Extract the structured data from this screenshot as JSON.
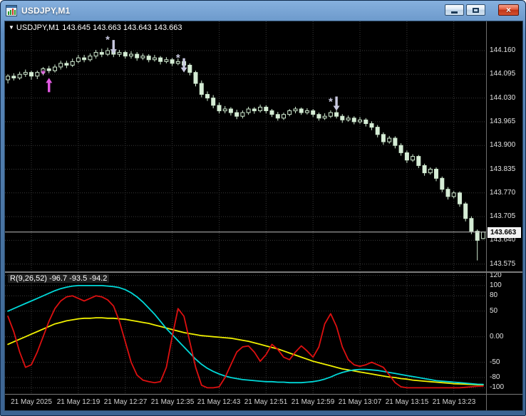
{
  "window": {
    "title": "USDJPY,M1",
    "close_glyph": "×"
  },
  "chart": {
    "symbol_header": {
      "dropdown_glyph": "▼",
      "symbol": "USDJPY,M1",
      "ohlc_values": "143.645 143.663 143.643 143.663"
    },
    "indicator_header": "R(9,26,52) -96.7 -93.5 -94.2",
    "price_axis": {
      "labels": [
        "144.160",
        "144.095",
        "144.030",
        "143.965",
        "143.900",
        "143.835",
        "143.770",
        "143.705",
        "143.640",
        "143.575"
      ],
      "current_price": "143.663"
    },
    "indicator_axis": {
      "labels": [
        "120",
        "100",
        "80",
        "50",
        "0.00",
        "-50",
        "-80",
        "-100"
      ]
    },
    "time_axis": {
      "labels": [
        "21 May 2025",
        "21 May 12:19",
        "21 May 12:27",
        "21 May 12:35",
        "21 May 12:43",
        "21 May 12:51",
        "21 May 12:59",
        "21 May 13:07",
        "21 May 13:15",
        "21 May 13:23"
      ]
    }
  },
  "colors": {
    "bull_body": "#000000",
    "bear_body": "#d6ecd6",
    "candle_outline": "#cfeacf",
    "grid": "#3a3a3a",
    "price_line": "#bdbdbd",
    "buy_marker": "#e259e2",
    "sell_marker": "#c7c7de"
  },
  "chart_data": {
    "type": "candlestick",
    "symbol": "USDJPY",
    "timeframe": "M1",
    "main": {
      "ylim": [
        143.555,
        144.24
      ],
      "grid_prices": [
        144.16,
        144.095,
        144.03,
        143.965,
        143.9,
        143.835,
        143.77,
        143.705,
        143.64,
        143.575
      ],
      "tick_indices": [
        4,
        12,
        20,
        28,
        36,
        44,
        52,
        60,
        68,
        76
      ],
      "current_price": 143.663,
      "marker_glyph": "*",
      "candles": [
        [
          144.08,
          144.095,
          144.07,
          144.09
        ],
        [
          144.09,
          144.098,
          144.078,
          144.085
        ],
        [
          144.085,
          144.102,
          144.08,
          144.095
        ],
        [
          144.095,
          144.108,
          144.088,
          144.1
        ],
        [
          144.1,
          144.105,
          144.08,
          144.09
        ],
        [
          144.09,
          144.105,
          144.082,
          144.1
        ],
        [
          144.1,
          144.115,
          144.092,
          144.11
        ],
        [
          144.11,
          144.118,
          144.098,
          144.105
        ],
        [
          144.105,
          144.122,
          144.1,
          144.115
        ],
        [
          144.115,
          144.132,
          144.108,
          144.125
        ],
        [
          144.125,
          144.132,
          144.112,
          144.12
        ],
        [
          144.12,
          144.138,
          144.115,
          144.13
        ],
        [
          144.13,
          144.148,
          144.125,
          144.14
        ],
        [
          144.14,
          144.148,
          144.128,
          144.135
        ],
        [
          144.135,
          144.152,
          144.13,
          144.145
        ],
        [
          144.145,
          144.162,
          144.138,
          144.155
        ],
        [
          144.155,
          144.165,
          144.142,
          144.15
        ],
        [
          144.15,
          144.168,
          144.145,
          144.16
        ],
        [
          144.16,
          144.17,
          144.142,
          144.15
        ],
        [
          144.15,
          144.162,
          144.143,
          144.155
        ],
        [
          144.155,
          144.16,
          144.138,
          144.145
        ],
        [
          144.145,
          144.158,
          144.138,
          144.15
        ],
        [
          144.15,
          144.156,
          144.132,
          144.14
        ],
        [
          144.14,
          144.152,
          144.134,
          144.145
        ],
        [
          144.145,
          144.15,
          144.128,
          144.135
        ],
        [
          144.135,
          144.148,
          144.13,
          144.14
        ],
        [
          144.14,
          144.145,
          144.122,
          144.13
        ],
        [
          144.13,
          144.142,
          144.125,
          144.135
        ],
        [
          144.135,
          144.14,
          144.118,
          144.125
        ],
        [
          144.125,
          144.138,
          144.12,
          144.13
        ],
        [
          144.13,
          144.135,
          144.112,
          144.12
        ],
        [
          144.12,
          144.125,
          144.092,
          144.1
        ],
        [
          144.1,
          144.105,
          144.062,
          144.07
        ],
        [
          144.07,
          144.078,
          144.032,
          144.04
        ],
        [
          144.04,
          144.048,
          144.022,
          144.03
        ],
        [
          144.03,
          144.038,
          144.002,
          144.01
        ],
        [
          144.01,
          144.018,
          143.988,
          143.995
        ],
        [
          143.995,
          144.008,
          143.988,
          144.0
        ],
        [
          144.0,
          144.005,
          143.982,
          143.99
        ],
        [
          143.99,
          143.998,
          143.972,
          143.98
        ],
        [
          143.98,
          143.996,
          143.974,
          143.99
        ],
        [
          143.99,
          144.006,
          143.984,
          144.0
        ],
        [
          144.0,
          144.005,
          143.987,
          143.995
        ],
        [
          143.995,
          144.012,
          143.99,
          144.005
        ],
        [
          144.005,
          144.01,
          143.988,
          143.995
        ],
        [
          143.995,
          144.0,
          143.978,
          143.985
        ],
        [
          143.985,
          143.992,
          143.968,
          143.975
        ],
        [
          143.975,
          143.99,
          143.97,
          143.985
        ],
        [
          143.985,
          144.0,
          143.98,
          143.995
        ],
        [
          143.995,
          144.006,
          143.988,
          144.0
        ],
        [
          144.0,
          144.004,
          143.984,
          143.99
        ],
        [
          143.99,
          144.002,
          143.985,
          143.995
        ],
        [
          143.995,
          144.0,
          143.978,
          143.985
        ],
        [
          143.985,
          143.99,
          143.968,
          143.975
        ],
        [
          143.975,
          143.988,
          143.97,
          143.98
        ],
        [
          143.98,
          143.996,
          143.975,
          143.99
        ],
        [
          143.99,
          143.996,
          143.974,
          143.98
        ],
        [
          143.98,
          143.986,
          143.962,
          143.97
        ],
        [
          143.97,
          143.982,
          143.965,
          143.975
        ],
        [
          143.975,
          143.98,
          143.958,
          143.965
        ],
        [
          143.965,
          143.978,
          143.96,
          143.97
        ],
        [
          143.97,
          143.975,
          143.952,
          143.96
        ],
        [
          143.96,
          143.966,
          143.942,
          143.95
        ],
        [
          143.95,
          143.956,
          143.922,
          143.93
        ],
        [
          143.93,
          143.936,
          143.902,
          143.91
        ],
        [
          143.91,
          143.926,
          143.905,
          143.92
        ],
        [
          143.92,
          143.925,
          143.892,
          143.9
        ],
        [
          143.9,
          143.906,
          143.872,
          143.88
        ],
        [
          143.88,
          143.886,
          143.852,
          143.86
        ],
        [
          143.86,
          143.876,
          143.855,
          143.87
        ],
        [
          143.87,
          143.874,
          143.838,
          143.845
        ],
        [
          143.845,
          143.85,
          143.817,
          143.825
        ],
        [
          143.825,
          143.84,
          143.82,
          143.835
        ],
        [
          143.835,
          143.84,
          143.802,
          143.81
        ],
        [
          143.81,
          143.815,
          143.772,
          143.78
        ],
        [
          143.78,
          143.786,
          143.752,
          143.76
        ],
        [
          143.76,
          143.775,
          143.755,
          143.77
        ],
        [
          143.77,
          143.774,
          143.732,
          143.74
        ],
        [
          143.74,
          143.745,
          143.692,
          143.7
        ],
        [
          143.7,
          143.706,
          143.657,
          143.665
        ],
        [
          143.665,
          143.67,
          143.585,
          143.64
        ],
        [
          143.645,
          143.663,
          143.643,
          143.663
        ]
      ],
      "markers": {
        "buy": [
          {
            "i": 7,
            "price": 144.085
          }
        ],
        "sell": [
          {
            "i": 18,
            "price": 144.15
          },
          {
            "i": 30,
            "price": 144.1
          },
          {
            "i": 56,
            "price": 143.995
          }
        ],
        "asterisks": [
          {
            "i": 6,
            "price": 144.097,
            "type": "buy"
          },
          {
            "i": 17,
            "price": 144.19,
            "type": "sell"
          },
          {
            "i": 29,
            "price": 144.14,
            "type": "sell"
          },
          {
            "i": 55,
            "price": 144.02,
            "type": "sell"
          }
        ]
      }
    },
    "indicator": {
      "name": "R(9,26,52)",
      "values_text": [
        "-96.7",
        "-93.5",
        "-94.2"
      ],
      "ylim": [
        -112,
        125
      ],
      "grid_values": [
        120,
        100,
        80,
        50,
        0,
        -50,
        -80,
        -100
      ],
      "series": [
        {
          "name": "yellow",
          "color": "#f0f000",
          "values": [
            -15,
            -10,
            -5,
            0,
            5,
            10,
            15,
            20,
            25,
            28,
            31,
            33,
            35,
            36,
            36,
            37,
            37,
            36,
            36,
            35,
            34,
            32,
            30,
            28,
            26,
            23,
            20,
            17,
            14,
            11,
            8,
            6,
            4,
            2,
            1,
            0,
            -1,
            -2,
            -3,
            -5,
            -7,
            -9,
            -12,
            -15,
            -18,
            -21,
            -24,
            -28,
            -32,
            -36,
            -40,
            -44,
            -48,
            -51,
            -54,
            -57,
            -60,
            -63,
            -65,
            -67,
            -69,
            -71,
            -73,
            -75,
            -77,
            -79,
            -80,
            -82,
            -83,
            -85,
            -86,
            -87,
            -88,
            -89,
            -90,
            -91,
            -92,
            -92.5,
            -93,
            -93.5,
            -94,
            -94.2
          ]
        },
        {
          "name": "cyan",
          "color": "#00d8d8",
          "values": [
            50,
            55,
            60,
            65,
            70,
            75,
            80,
            85,
            90,
            94,
            97,
            99,
            100,
            100,
            100,
            100,
            100,
            99,
            98,
            96,
            92,
            86,
            78,
            68,
            56,
            44,
            30,
            16,
            4,
            -8,
            -20,
            -32,
            -44,
            -54,
            -62,
            -68,
            -73,
            -77,
            -80,
            -82,
            -84,
            -85,
            -86,
            -87,
            -88,
            -88,
            -89,
            -89,
            -90,
            -90,
            -90,
            -89,
            -88,
            -86,
            -83,
            -79,
            -74,
            -70,
            -67,
            -65,
            -64,
            -64,
            -65,
            -66,
            -68,
            -70,
            -72,
            -74,
            -76,
            -78,
            -80,
            -82,
            -84,
            -86,
            -87,
            -88,
            -89,
            -90,
            -91,
            -92,
            -93,
            -93.5
          ]
        },
        {
          "name": "red",
          "color": "#dd1010",
          "values": [
            40,
            10,
            -30,
            -60,
            -55,
            -30,
            0,
            30,
            55,
            70,
            78,
            80,
            75,
            70,
            75,
            80,
            78,
            72,
            60,
            30,
            -10,
            -50,
            -75,
            -85,
            -88,
            -90,
            -88,
            -60,
            0,
            55,
            40,
            -10,
            -60,
            -95,
            -100,
            -100,
            -98,
            -80,
            -55,
            -30,
            -20,
            -18,
            -30,
            -48,
            -35,
            -15,
            -25,
            -40,
            -45,
            -30,
            -18,
            -28,
            -40,
            -20,
            25,
            45,
            20,
            -20,
            -45,
            -55,
            -58,
            -55,
            -50,
            -55,
            -60,
            -75,
            -90,
            -98,
            -100,
            -100,
            -100,
            -100,
            -100,
            -100,
            -100,
            -100,
            -100,
            -100,
            -99,
            -98,
            -97,
            -96.7
          ]
        }
      ]
    }
  }
}
